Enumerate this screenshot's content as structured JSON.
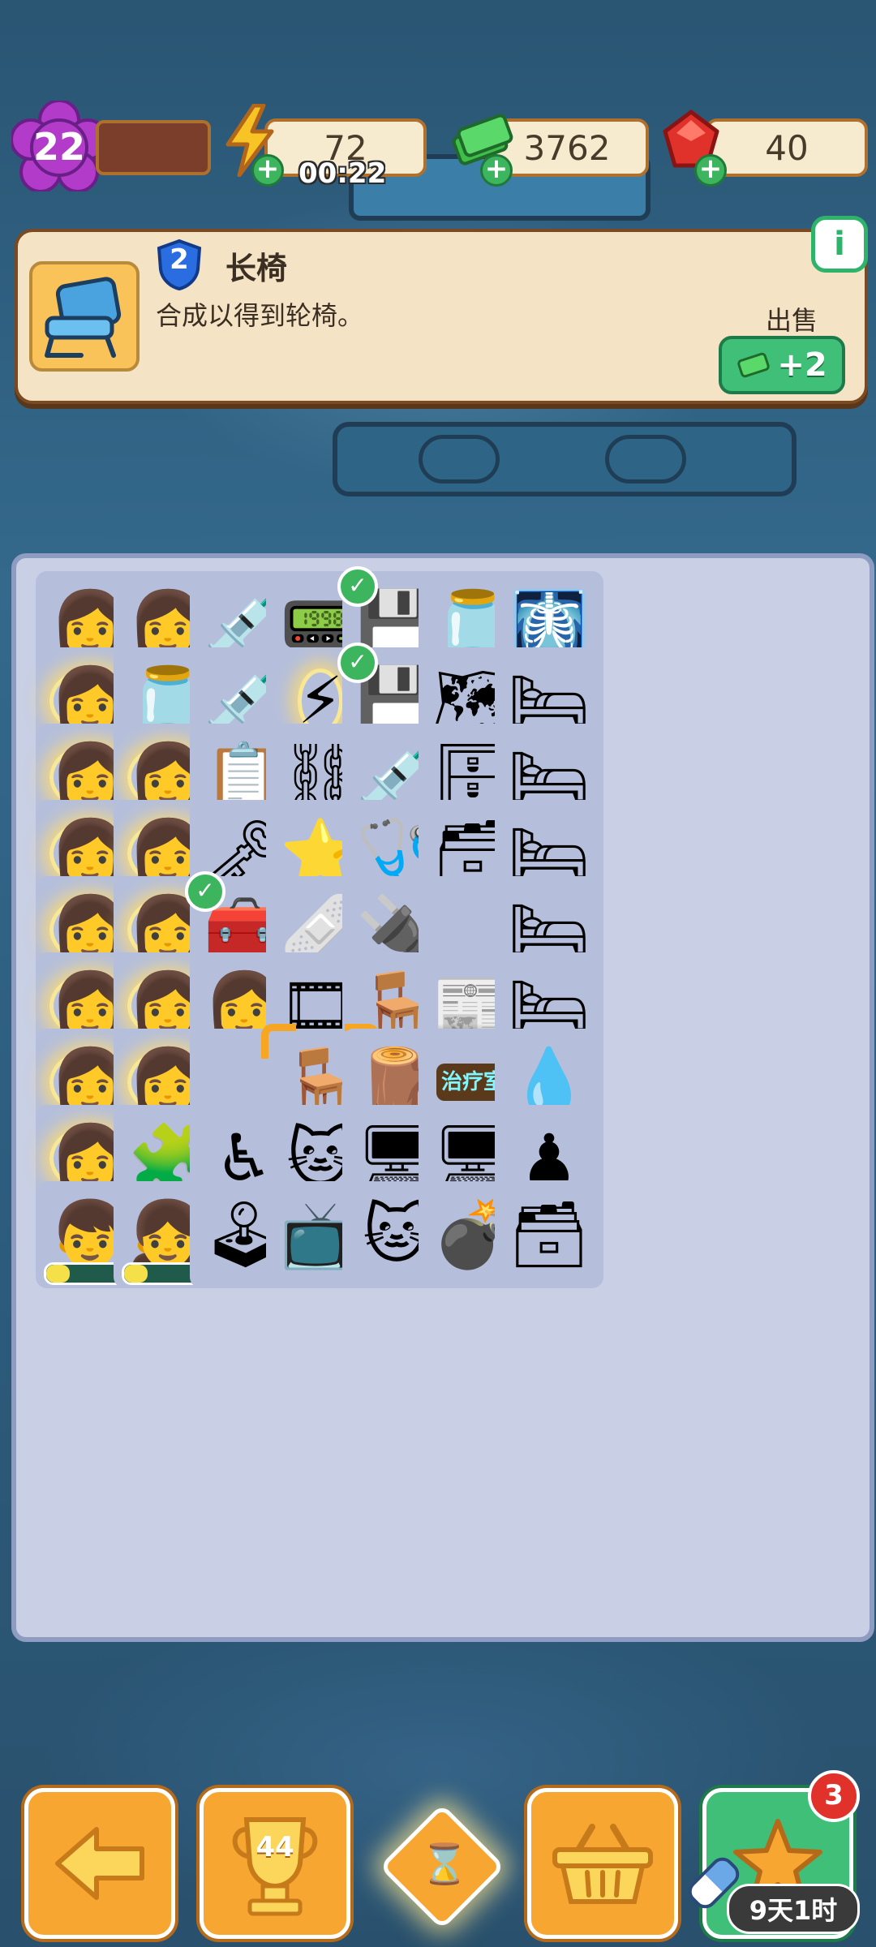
{
  "header": {
    "level": "22",
    "energy": "72",
    "energy_timer": "00:22",
    "cash": "3762",
    "gems": "40"
  },
  "info_panel": {
    "item_level": "2",
    "item_name": "长椅",
    "description": "合成以得到轮椅。",
    "sell_label": "出售",
    "sell_value": "+2",
    "info_icon": "i"
  },
  "board": {
    "rows": [
      [
        {
          "icon": "patient-girl-icon",
          "glyph": "👩"
        },
        {
          "icon": "patient-girl-icon",
          "glyph": "👩"
        },
        {
          "icon": "blood-syringe-icon",
          "glyph": "💉"
        },
        {
          "icon": "tamagotchi-icon",
          "glyph": "📟"
        },
        {
          "icon": "floppy-disk-icon",
          "glyph": "💾",
          "check": true
        },
        {
          "icon": "brain-jar-icon",
          "glyph": "🫙"
        },
        {
          "icon": "xray-device-icon",
          "glyph": "🩻"
        }
      ],
      [
        {
          "icon": "patient-girl-icon",
          "glyph": "👩",
          "glow": true
        },
        {
          "icon": "specimen-jar-icon",
          "glyph": "🫙"
        },
        {
          "icon": "blood-syringe-icon",
          "glyph": "💉"
        },
        {
          "icon": "energy-orb-icon",
          "glyph": "⚡",
          "glow": true
        },
        {
          "icon": "floppy-disk-icon",
          "glyph": "💾",
          "check": true
        },
        {
          "icon": "old-map-icon",
          "glyph": "🗺"
        },
        {
          "icon": "hospital-bed-icon",
          "glyph": "🛏",
          "progress": 0.2
        }
      ],
      [
        {
          "icon": "patient-girl-icon",
          "glyph": "👩",
          "glow": true
        },
        {
          "icon": "patient-girl-icon",
          "glyph": "👩",
          "glow": true
        },
        {
          "icon": "xray-folder-icon",
          "glyph": "📋"
        },
        {
          "icon": "handcuffs-icon",
          "glyph": "⛓"
        },
        {
          "icon": "blood-syringe-icon",
          "glyph": "💉"
        },
        {
          "icon": "cage-icon",
          "glyph": "🗄"
        },
        {
          "icon": "hospital-bed-icon",
          "glyph": "🛏",
          "progress": 0.2
        }
      ],
      [
        {
          "icon": "patient-girl-icon",
          "glyph": "👩",
          "glow": true
        },
        {
          "icon": "patient-girl-icon",
          "glyph": "👩",
          "glow": true
        },
        {
          "icon": "keys-icon",
          "glyph": "🗝"
        },
        {
          "icon": "purple-star-icon",
          "glyph": "⭐"
        },
        {
          "icon": "stethoscope-icon",
          "glyph": "🩺"
        },
        {
          "icon": "nurse-desk-icon",
          "glyph": "🗃"
        },
        {
          "icon": "hospital-bed-icon",
          "glyph": "🛏",
          "progress": 0.2
        }
      ],
      [
        {
          "icon": "patient-girl-icon",
          "glyph": "👩",
          "glow": true
        },
        {
          "icon": "patient-girl-icon",
          "glyph": "👩",
          "glow": true
        },
        {
          "icon": "first-aid-box-icon",
          "glyph": "🧰",
          "check": true
        },
        {
          "icon": "bandage-roll-icon",
          "glyph": "🩹"
        },
        {
          "icon": "usb-drive-icon",
          "glyph": "🔌"
        },
        {
          "icon": "empty-slot",
          "glyph": ""
        },
        {
          "icon": "blue-bed-icon",
          "glyph": "🛏"
        }
      ],
      [
        {
          "icon": "patient-girl-icon",
          "glyph": "👩",
          "glow": true
        },
        {
          "icon": "patient-girl-icon",
          "glyph": "👩",
          "glow": true
        },
        {
          "icon": "patient-girl-icon",
          "glyph": "👩"
        },
        {
          "icon": "film-strip-icon",
          "glyph": "🎞"
        },
        {
          "icon": "stool-icon",
          "glyph": "🪑"
        },
        {
          "icon": "newspaper-icon",
          "glyph": "📰"
        },
        {
          "icon": "blue-bed-icon",
          "glyph": "🛏"
        }
      ],
      [
        {
          "icon": "patient-girl-icon",
          "glyph": "👩",
          "glow": true
        },
        {
          "icon": "patient-girl-icon",
          "glyph": "👩",
          "glow": true
        },
        {
          "icon": "empty-slot",
          "glyph": ""
        },
        {
          "icon": "bench-chair-icon",
          "glyph": "🪑",
          "selected": true
        },
        {
          "icon": "wooden-desk-icon",
          "glyph": "🪵"
        },
        {
          "icon": "treatment-room-sign-icon",
          "glyph": "🪧",
          "text": "治疗室"
        },
        {
          "icon": "iv-bag-icon",
          "glyph": "💧"
        }
      ],
      [
        {
          "icon": "patient-girl-icon",
          "glyph": "👩",
          "glow": true
        },
        {
          "icon": "puzzle-pieces-icon",
          "glyph": "🧩"
        },
        {
          "icon": "wheelchair-icon",
          "glyph": "♿"
        },
        {
          "icon": "cat-plush-icon",
          "glyph": "🐱"
        },
        {
          "icon": "computer-desk-icon",
          "glyph": "🖥"
        },
        {
          "icon": "computer-desk-icon",
          "glyph": "🖥"
        },
        {
          "icon": "board-game-icon",
          "glyph": "♟"
        }
      ],
      [
        {
          "icon": "boy-character-icon",
          "glyph": "👦",
          "progress": 0.25
        },
        {
          "icon": "girl-character-icon",
          "glyph": "👧",
          "progress": 0.25
        },
        {
          "icon": "arcade-machine-icon",
          "glyph": "🕹"
        },
        {
          "icon": "retro-tv-icon",
          "glyph": "📺"
        },
        {
          "icon": "cat-face-icon",
          "glyph": "🐱"
        },
        {
          "icon": "ball-chain-icon",
          "glyph": "💣"
        },
        {
          "icon": "medicine-desk-icon",
          "glyph": "🗃"
        }
      ]
    ]
  },
  "bottom": {
    "trophy_count": "44",
    "notification_count": "3",
    "event_time": "9天1时"
  },
  "colors": {
    "accent": "#f6a631",
    "green": "#3fbf78",
    "board": "#c9cfe4"
  }
}
